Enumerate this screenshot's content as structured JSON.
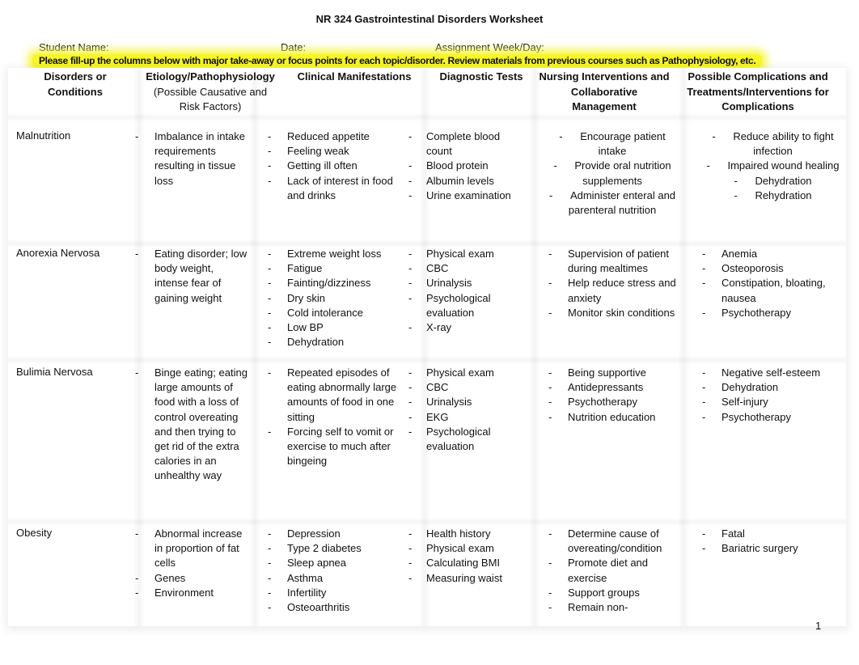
{
  "document": {
    "title": "NR 324 Gastrointestinal Disorders Worksheet",
    "student_name_label": "Student Name:",
    "date_label": "Date:",
    "assignment_label": "Assignment Week/Day:",
    "instructions": "Please fill-up the columns below with major take-away or focus points for each topic/disorder. Review materials from previous courses such as Pathophysiology, etc.",
    "highlight_color": "#f6f62a",
    "page_number": "1"
  },
  "headers": {
    "disorders": "Disorders or Conditions",
    "etiology": "Etiology/Pathophysiology",
    "etiology_sub": "(Possible Causative and Risk Factors)",
    "clinical": "Clinical Manifestations",
    "diagnostic": "Diagnostic Tests",
    "nursing": "Nursing Interventions and Collaborative Management",
    "complications": "Possible Complications and Treatments/Interventions for Complications"
  },
  "rows": [
    {
      "disorder": "Malnutrition",
      "etiology": [
        "Imbalance in intake requirements resulting in tissue loss"
      ],
      "clinical": [
        "Reduced appetite",
        "Feeling weak",
        "Getting ill often",
        "Lack of interest in food and drinks"
      ],
      "diagnostic": [
        "Complete blood count",
        "Blood protein",
        "Albumin levels",
        "Urine examination"
      ],
      "nursing": [
        "Encourage patient intake",
        "Provide oral nutrition supplements",
        "Administer enteral and parenteral nutrition"
      ],
      "complications": [
        "Reduce ability to fight infection",
        "Impaired wound healing",
        "Dehydration",
        "Rehydration"
      ]
    },
    {
      "disorder": "Anorexia Nervosa",
      "etiology": [
        "Eating disorder; low body weight, intense fear of gaining weight"
      ],
      "clinical": [
        "Extreme weight loss",
        "Fatigue",
        "Fainting/dizziness",
        "Dry skin",
        "Cold intolerance",
        "Low BP",
        "Dehydration"
      ],
      "diagnostic": [
        "Physical exam",
        "CBC",
        "Urinalysis",
        "Psychological evaluation",
        "X-ray"
      ],
      "nursing": [
        "Supervision of patient during mealtimes",
        "Help reduce stress and anxiety",
        "Monitor skin conditions"
      ],
      "complications": [
        "Anemia",
        "Osteoporosis",
        "Constipation, bloating, nausea",
        "Psychotherapy"
      ]
    },
    {
      "disorder": "Bulimia Nervosa",
      "etiology": [
        "Binge eating; eating large amounts of food with a loss of control overeating and then trying to get rid of the extra calories in an unhealthy way"
      ],
      "clinical": [
        "Repeated episodes of eating abnormally large amounts of food in one sitting",
        "Forcing self to vomit or exercise to much after bingeing"
      ],
      "diagnostic": [
        "Physical exam",
        "CBC",
        "Urinalysis",
        "EKG",
        "Psychological evaluation"
      ],
      "nursing": [
        "Being supportive",
        "Antidepressants",
        "Psychotherapy",
        "Nutrition education"
      ],
      "complications": [
        "Negative self-esteem",
        "Dehydration",
        "Self-injury",
        "Psychotherapy"
      ]
    },
    {
      "disorder": "Obesity",
      "etiology": [
        "Abnormal increase in proportion of fat cells",
        "Genes",
        "Environment"
      ],
      "clinical": [
        "Depression",
        "Type 2 diabetes",
        "Sleep apnea",
        "Asthma",
        "Infertility",
        "Osteoarthritis"
      ],
      "diagnostic": [
        "Health history",
        "Physical exam",
        "Calculating BMI",
        "Measuring waist"
      ],
      "nursing": [
        "Determine cause of overeating/condition",
        "Promote diet and exercise",
        "Support groups",
        "Remain non-"
      ],
      "complications": [
        "Fatal",
        "Bariatric surgery"
      ]
    }
  ]
}
